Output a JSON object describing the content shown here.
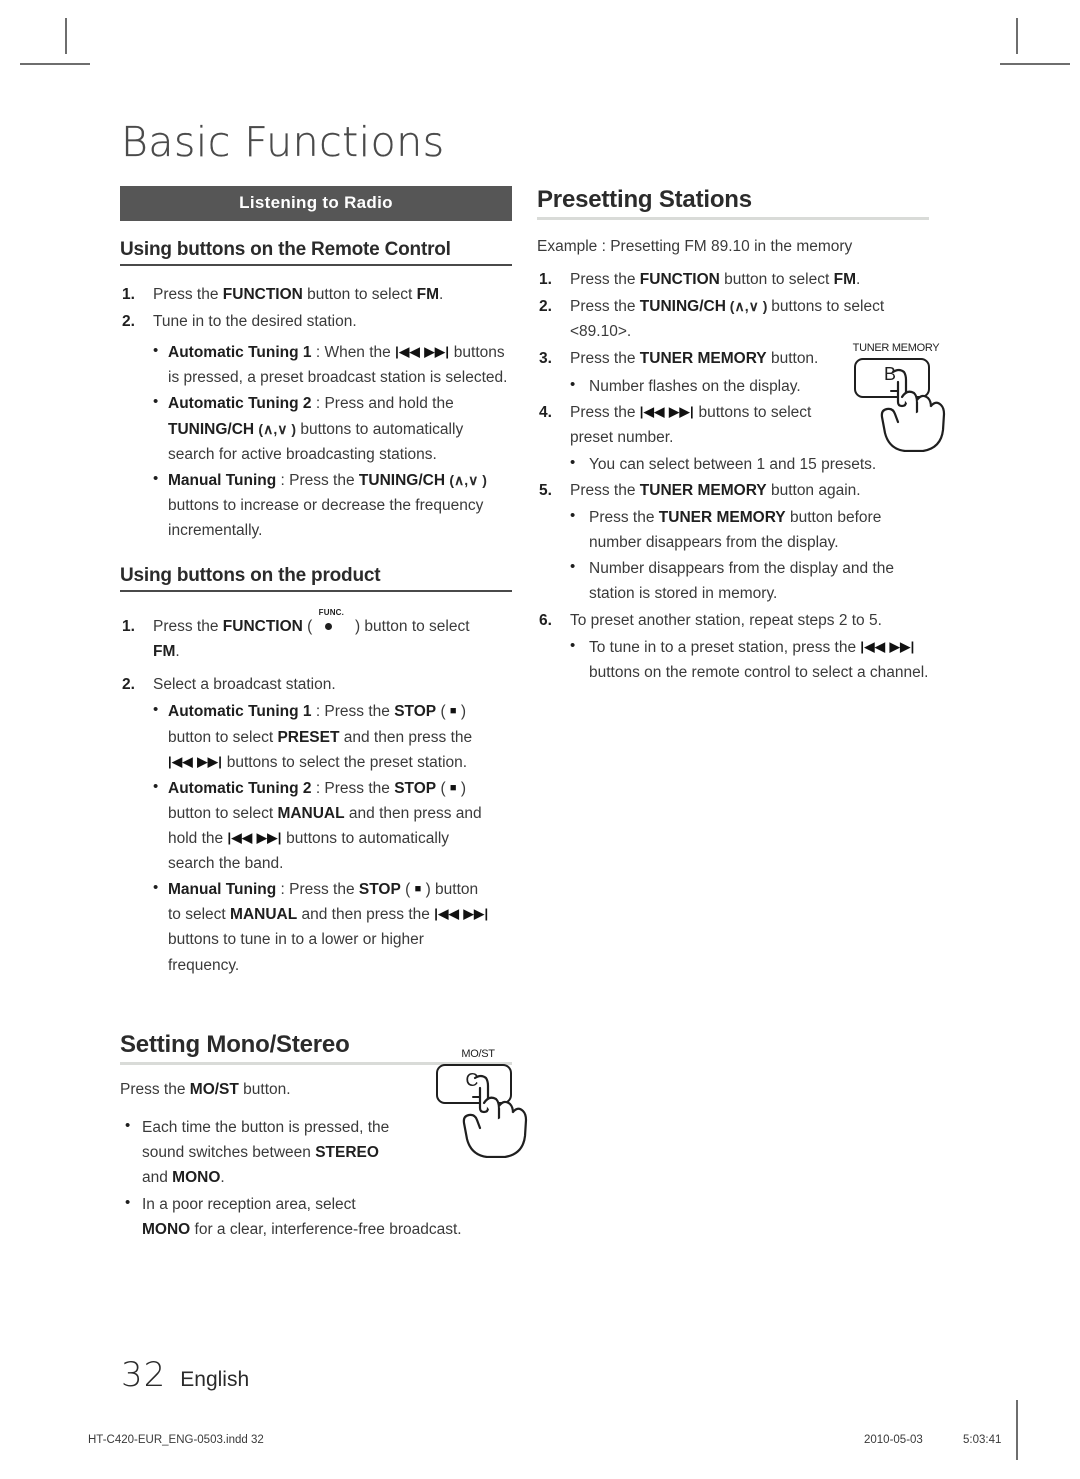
{
  "page": {
    "chapter_title": "Basic Functions",
    "page_number": "32",
    "language": "English"
  },
  "footer": {
    "file_name": "HT-C420-EUR_ENG-0503.indd   32",
    "date": "2010-05-03",
    "time": "5:03:41"
  },
  "colors": {
    "header_bar_bg": "#565656",
    "header_bar_text": "#ffffff",
    "rule_dark": "#4a4a4a",
    "rule_light": "#d9dbd8",
    "body_text": "#3a3a3a"
  },
  "left_column": {
    "section_bar": "Listening to Radio",
    "sub_heading_remote": "Using buttons on the Remote Control",
    "remote_steps": [
      {
        "num": "1.",
        "text_parts": [
          {
            "t": "Press the ",
            "b": false
          },
          {
            "t": "FUNCTION",
            "b": true
          },
          {
            "t": " button to select ",
            "b": false
          },
          {
            "t": "FM",
            "b": true
          },
          {
            "t": ".",
            "b": false
          }
        ]
      },
      {
        "num": "2.",
        "text_parts": [
          {
            "t": "Tune in to the desired station.",
            "b": false
          }
        ]
      }
    ],
    "remote_bullets": [
      "Automatic Tuning 1 : When the |◀◀ ▶▶| buttons is pressed, a preset broadcast station is selected.",
      "Automatic Tuning 2 : Press and hold the TUNING/CH (∧,∨) buttons to automatically search for active broadcasting stations.",
      "Manual Tuning : Press the TUNING/CH (∧,∨) buttons to increase or decrease the frequency incrementally."
    ],
    "bullet_labels": {
      "auto1": "Automatic Tuning 1",
      "auto2": "Automatic Tuning 2",
      "manual": "Manual Tuning",
      "colon": " : ",
      "colon_thin": " : "
    },
    "b1_rest_a": "When the ",
    "b1_rest_b": " buttons",
    "b1_line2": "is pressed, a preset broadcast station is selected.",
    "b2_rest": "Press and hold the",
    "b2_line2_bold": "TUNING/CH",
    "b2_line2_rest": " buttons to automatically",
    "b2_line3": "search for active broadcasting stations.",
    "b3_rest": "Press the ",
    "b3_bold": "TUNING/CH",
    "b3_line2": "buttons to increase or decrease the frequency",
    "b3_line3": "incrementally.",
    "sub_heading_product": "Using buttons on the product",
    "product_step1": {
      "num": "1.",
      "pre": "Press the ",
      "bold": "FUNCTION",
      "paren_open": " ( ",
      "func_label": "FUNC.",
      "paren_close": " ) ",
      "post": "button to select",
      "line2_bold": "FM",
      "line2_rest": "."
    },
    "product_step2": {
      "num": "2.",
      "text": "Select a broadcast station."
    },
    "product_bullets": {
      "auto1_label": "Automatic Tuning 1",
      "auto1_mid": " : Press the ",
      "auto1_stop": "STOP",
      "auto1_paren": " (  ) ",
      "auto1_l2_pre": "button to select ",
      "auto1_l2_bold": "PRESET",
      "auto1_l2_post": " and then press the",
      "auto1_l3": " buttons to select the preset station.",
      "auto2_label": "Automatic Tuning 2",
      "auto2_mid": " : Press the ",
      "auto2_stop": "STOP",
      "auto2_l2_pre": "button to select ",
      "auto2_l2_bold": "MANUAL",
      "auto2_l2_post": " and then press and",
      "auto2_l3_pre": "hold the ",
      "auto2_l3_post": " buttons to automatically",
      "auto2_l4": "search the band.",
      "manual_label": "Manual Tuning",
      "manual_mid": " : Press the ",
      "manual_stop": "STOP",
      "manual_post": " ) button",
      "manual_l2_pre": "to select ",
      "manual_l2_bold": "MANUAL",
      "manual_l2_post": " and then press the ",
      "manual_l3": "buttons to tune in to a lower or higher",
      "manual_l4": "frequency."
    },
    "mono_heading": "Setting Mono/Stereo",
    "mono_intro_pre": "Press the ",
    "mono_intro_bold": "MO/ST",
    "mono_intro_post": " button.",
    "mono_bullets": {
      "b1_l1": "Each time the button is pressed, the",
      "b1_l2_pre": "sound switches between ",
      "b1_l2_bold": "STEREO",
      "b1_l3_pre": "and ",
      "b1_l3_bold": "MONO",
      "b1_l3_post": ".",
      "b2_l1": "In a poor reception area, select",
      "b2_l2_bold": "MONO",
      "b2_l2_post": " for a clear, interference-free broadcast."
    }
  },
  "right_column": {
    "heading": "Presetting Stations",
    "example": "Example : Presetting FM 89.10 in the memory",
    "step1": {
      "num": "1.",
      "pre": "Press the ",
      "bold": "FUNCTION",
      "mid": " button to select ",
      "bold2": "FM",
      "post": "."
    },
    "step2": {
      "num": "2.",
      "pre": "Press the ",
      "bold": "TUNING/CH",
      "paren": " (∧,∨ ) ",
      "post": "buttons to select",
      "line2": "<89.10>."
    },
    "step3": {
      "num": "3.",
      "pre": "Press the ",
      "bold": "TUNER MEMORY",
      "post": " button.",
      "bullet": "Number flashes on the display."
    },
    "step4": {
      "num": "4.",
      "pre": "Press the ",
      "post": " buttons to select",
      "line2": "preset number.",
      "bullet": "You can select between 1 and 15 presets."
    },
    "step5": {
      "num": "5.",
      "pre": "Press the ",
      "bold": "TUNER MEMORY",
      "post": " button again.",
      "bullet1_pre": "Press the ",
      "bullet1_bold": "TUNER MEMORY",
      "bullet1_post": " button before",
      "bullet1_l2": "number disappears from the display.",
      "bullet2_l1": "Number disappears from the display and the",
      "bullet2_l2": "station is stored in memory."
    },
    "step6": {
      "num": "6.",
      "text": "To preset another station, repeat steps 2 to 5.",
      "bullet_pre": "To tune in to a preset station, press the ",
      "bullet_l2": "buttons on the remote control to select a channel."
    }
  },
  "figures": {
    "tuner_memory": {
      "caption": "TUNER MEMORY",
      "button_label": "B"
    },
    "most": {
      "caption": "MO/ST",
      "button_label": "C"
    }
  },
  "glyphs": {
    "transport": "|◀◀  ▶▶|",
    "prev": "|◀◀",
    "next": "▶▶|",
    "stop_square": "■",
    "chev_up": "∧",
    "chev_down": "∨",
    "bullet": "•"
  }
}
